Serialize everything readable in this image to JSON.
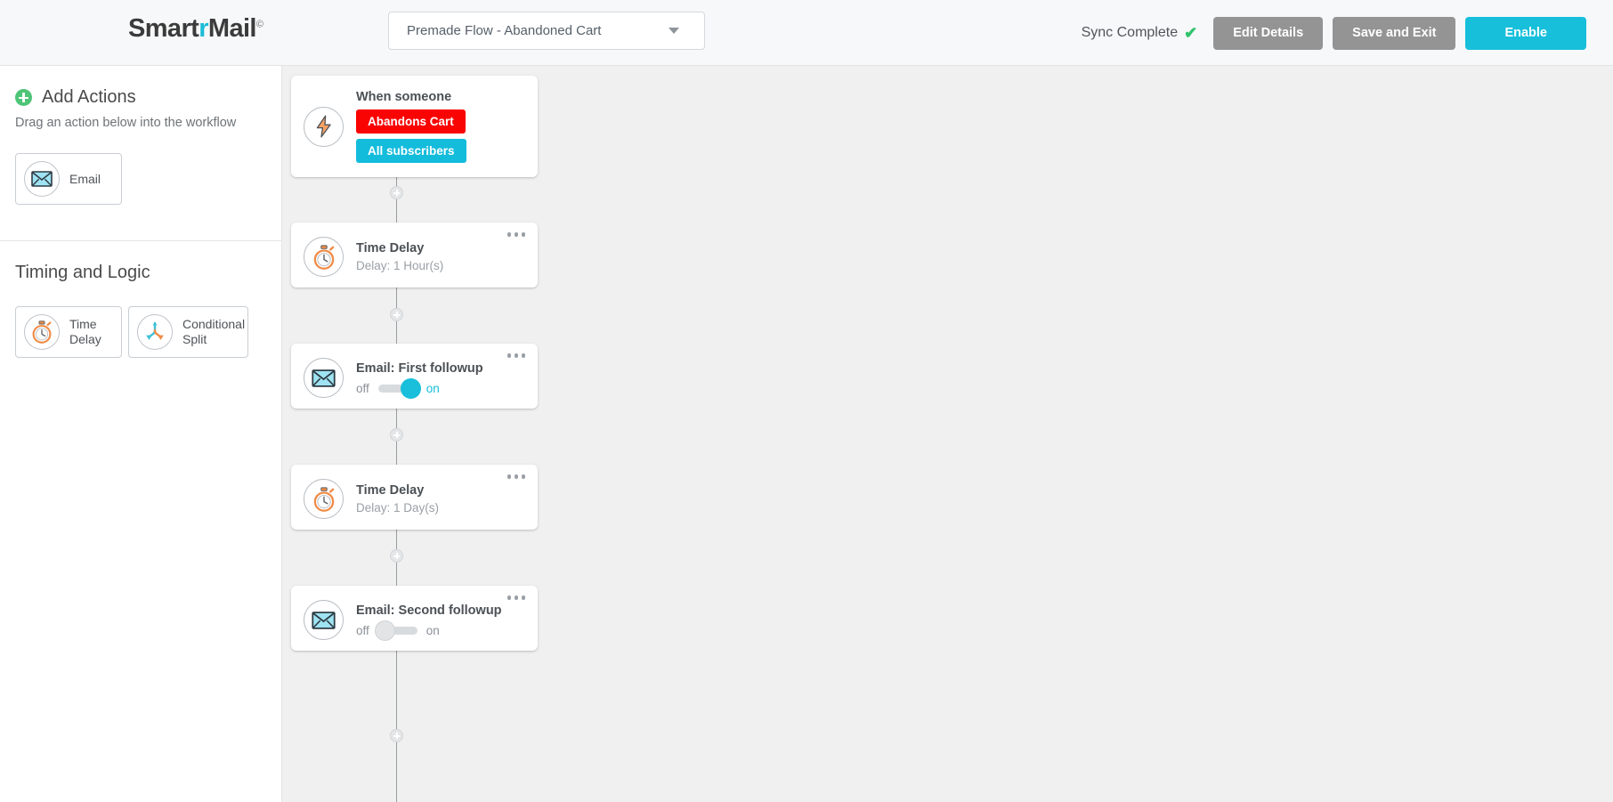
{
  "header": {
    "logo_main1": "Smart",
    "logo_accent": "r",
    "logo_main2": "Mail",
    "logo_reg": "©",
    "flow_name": "Premade Flow - Abandoned Cart",
    "caret_icon": "chevron-down-icon",
    "sync_text": "Sync Complete",
    "sync_check": "✔",
    "buttons": [
      {
        "label": "Edit Details",
        "style": "grey"
      },
      {
        "label": "Save and Exit",
        "style": "grey"
      },
      {
        "label": "Enable",
        "style": "cyan"
      }
    ]
  },
  "sidebar": {
    "add_actions_title": "Add Actions",
    "add_actions_sub": "Drag an action below into the workflow",
    "plus_icon": "plus-circle-icon",
    "actions": [
      {
        "label": "Email",
        "icon": "envelope-icon"
      }
    ],
    "timing_title": "Timing and Logic",
    "timing_items": [
      {
        "label": "Time Delay",
        "icon": "stopwatch-icon"
      },
      {
        "label": "Conditional Split",
        "label_l1": "Conditional",
        "label_l2": "Split",
        "icon": "split-arrows-icon"
      }
    ]
  },
  "canvas": {
    "nodes": [
      {
        "type": "trigger",
        "icon": "lightning-bolt-icon",
        "title": "When someone",
        "badges": [
          {
            "text": "Abandons Cart",
            "color": "#f90303"
          },
          {
            "text": "All subscribers",
            "color": "#14bcdb"
          }
        ]
      },
      {
        "type": "delay",
        "icon": "stopwatch-icon",
        "title": "Time Delay",
        "subtitle": "Delay: 1 Hour(s)",
        "menu_icon": "ellipsis-icon"
      },
      {
        "type": "email",
        "icon": "envelope-icon",
        "title": "Email: First followup",
        "toggle_off_label": "off",
        "toggle_on_label": "on",
        "toggle_state": "on",
        "menu_icon": "ellipsis-icon"
      },
      {
        "type": "delay",
        "icon": "stopwatch-icon",
        "title": "Time Delay",
        "subtitle": "Delay: 1 Day(s)",
        "menu_icon": "ellipsis-icon"
      },
      {
        "type": "email",
        "icon": "envelope-icon",
        "title": "Email: Second followup",
        "toggle_off_label": "off",
        "toggle_on_label": "on",
        "toggle_state": "off",
        "menu_icon": "ellipsis-icon"
      }
    ],
    "connector_icon": "add-step-icon"
  },
  "colors": {
    "accent_cyan": "#17bfdb",
    "badge_red": "#f90303",
    "badge_cyan": "#14bcdb",
    "green_check": "#2fc36a",
    "button_grey": "#949494"
  }
}
